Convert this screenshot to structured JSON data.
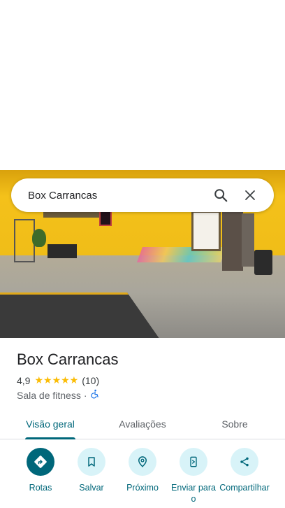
{
  "search": {
    "query": "Box Carrancas"
  },
  "icons": {
    "search": "search-icon",
    "close": "close-icon",
    "accessibility": "wheelchair-icon"
  },
  "place": {
    "name": "Box Carrancas",
    "rating": "4,9",
    "stars": "★★★★★",
    "reviews_count": "(10)",
    "category": "Sala de fitness",
    "separator": "·"
  },
  "tabs": [
    {
      "label": "Visão geral",
      "active": true
    },
    {
      "label": "Avaliações",
      "active": false
    },
    {
      "label": "Sobre",
      "active": false
    }
  ],
  "actions": [
    {
      "label": "Rotas",
      "icon": "directions-icon"
    },
    {
      "label": "Salvar",
      "icon": "bookmark-icon"
    },
    {
      "label": "Próximo",
      "icon": "nearby-icon"
    },
    {
      "label": "Enviar para o",
      "icon": "send-to-phone-icon"
    },
    {
      "label": "Compartilhar",
      "icon": "share-icon"
    }
  ],
  "colors": {
    "accent": "#00677a",
    "accent_light": "#d8f3f8",
    "star": "#fbbc04"
  }
}
